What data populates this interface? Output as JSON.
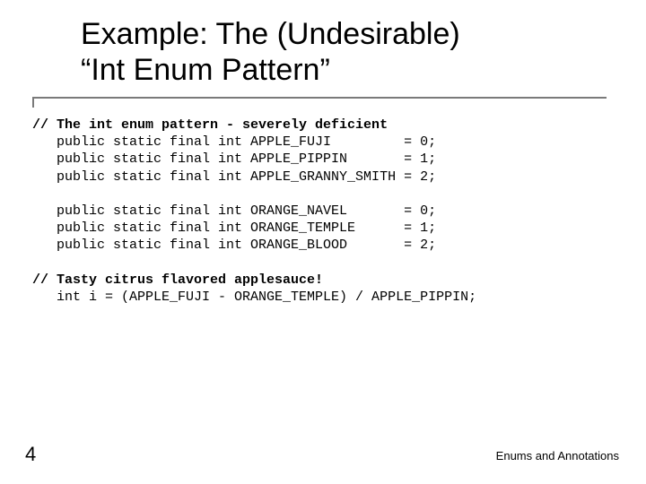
{
  "title": {
    "line1": "Example: The (Undesirable)",
    "line2": "“Int Enum Pattern”"
  },
  "code": {
    "comment1": "// The int enum pattern - severely deficient",
    "apple_fuji": "   public static final int APPLE_FUJI         = 0;",
    "apple_pippin": "   public static final int APPLE_PIPPIN       = 1;",
    "apple_granny": "   public static final int APPLE_GRANNY_SMITH = 2;",
    "blank1": "",
    "orange_navel": "   public static final int ORANGE_NAVEL       = 0;",
    "orange_temple": "   public static final int ORANGE_TEMPLE      = 1;",
    "orange_blood": "   public static final int ORANGE_BLOOD       = 2;",
    "blank2": "",
    "comment2": "// Tasty citrus flavored applesauce!",
    "expr": "   int i = (APPLE_FUJI - ORANGE_TEMPLE) / APPLE_PIPPIN;"
  },
  "page_number": "4",
  "footer": "Enums and Annotations"
}
